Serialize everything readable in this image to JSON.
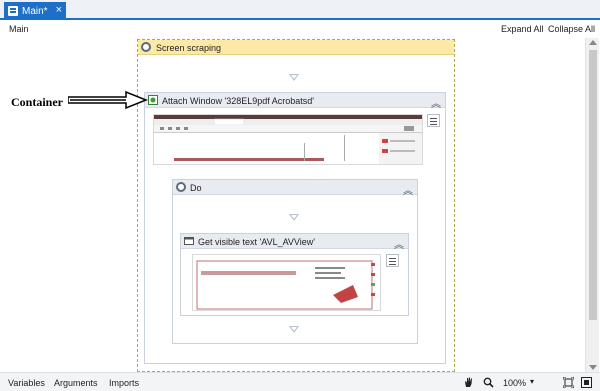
{
  "tab": {
    "label": "Main*",
    "close": "×"
  },
  "breadcrumb": "Main",
  "toolbar": {
    "expand_all": "Expand All",
    "collapse_all": "Collapse All"
  },
  "scope": {
    "title": "Screen scraping"
  },
  "attach": {
    "title": "Attach Window '328EL9pdf Acrobatsd'"
  },
  "do_seq": {
    "title": "Do"
  },
  "get_text": {
    "title": "Get visible text 'AVL_AVView'"
  },
  "annotation": "Container",
  "statusbar": {
    "variables": "Variables",
    "arguments": "Arguments",
    "imports": "Imports",
    "zoom": "100%"
  },
  "icons": [
    "document-icon",
    "gear-icon",
    "window-icon",
    "chevron-up-icon",
    "hamburger-icon",
    "drop-arrow-icon",
    "hand-icon",
    "search-icon",
    "fit-icon",
    "overview-icon",
    "arrow-icon"
  ]
}
